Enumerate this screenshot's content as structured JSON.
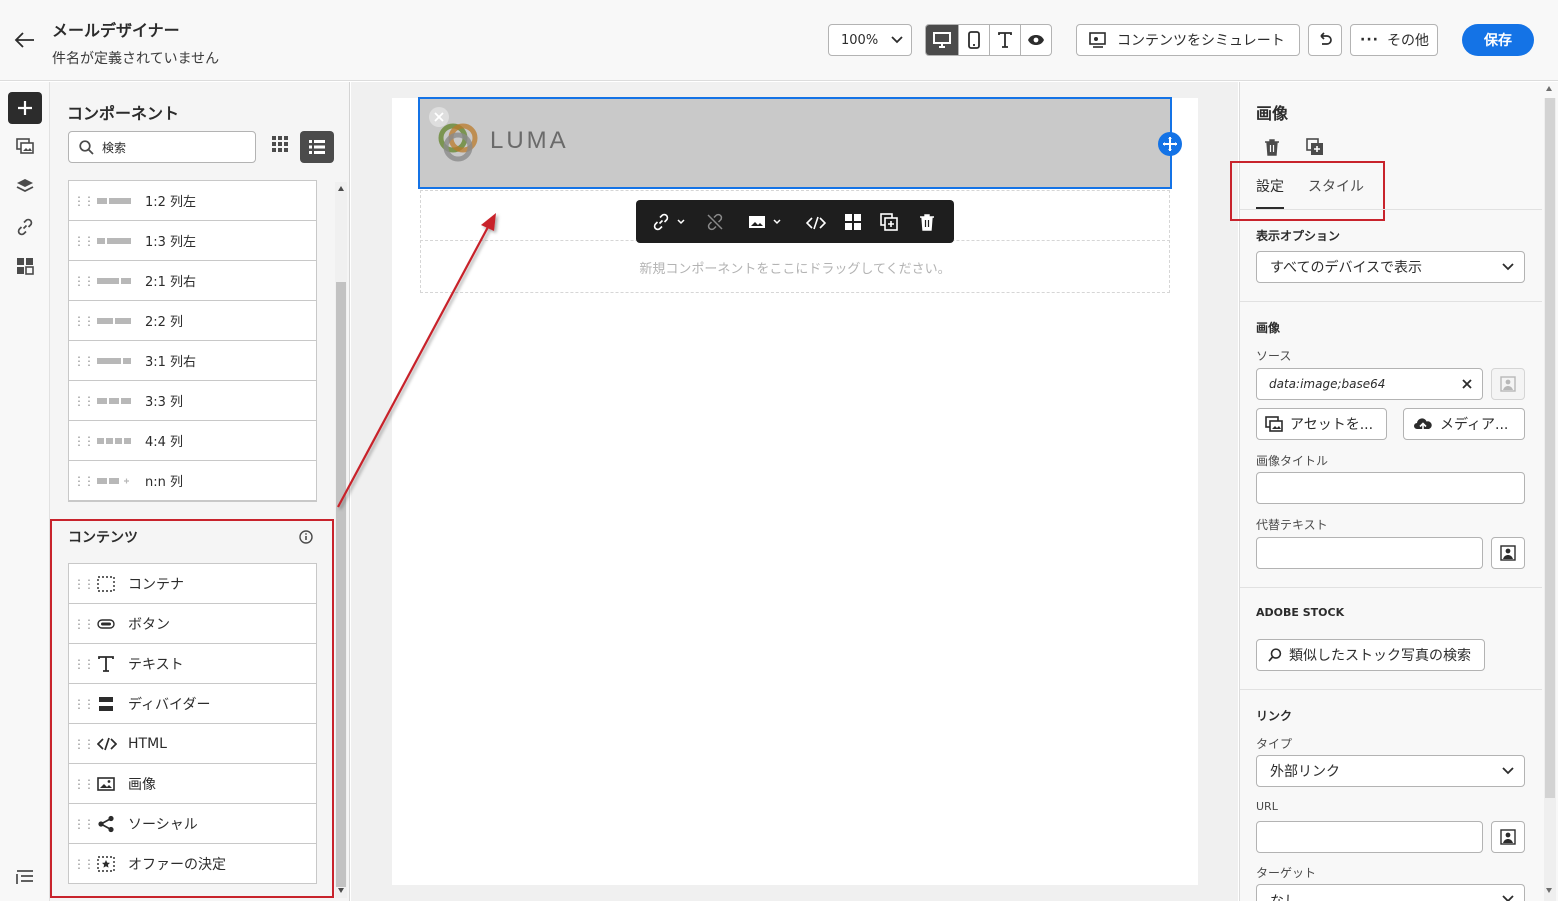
{
  "header": {
    "title": "メールデザイナー",
    "subtitle": "件名が定義されていません",
    "zoom": "100%",
    "simulate_label": "コンテンツをシミュレート",
    "more_label": "その他",
    "save_label": "保存"
  },
  "left_panel": {
    "title": "コンポーネント",
    "search_placeholder": "検索",
    "layouts": [
      {
        "label": "1:2 列左"
      },
      {
        "label": "1:3 列左"
      },
      {
        "label": "2:1 列右"
      },
      {
        "label": "2:2 列"
      },
      {
        "label": "3:1 列右"
      },
      {
        "label": "3:3 列"
      },
      {
        "label": "4:4 列"
      },
      {
        "label": "n:n 列"
      }
    ],
    "contents_title": "コンテンツ",
    "contents": [
      {
        "label": "コンテナ",
        "icon": "container-icon"
      },
      {
        "label": "ボタン",
        "icon": "button-icon"
      },
      {
        "label": "テキスト",
        "icon": "text-icon"
      },
      {
        "label": "ディバイダー",
        "icon": "divider-icon"
      },
      {
        "label": "HTML",
        "icon": "code-icon"
      },
      {
        "label": "画像",
        "icon": "image-icon"
      },
      {
        "label": "ソーシャル",
        "icon": "share-icon"
      },
      {
        "label": "オファーの決定",
        "icon": "offer-icon"
      }
    ]
  },
  "canvas": {
    "logo_text": "LUMA",
    "drop_hint": "新規コンポーネントをここにドラッグしてください。"
  },
  "right_panel": {
    "title": "画像",
    "tabs": [
      "設定",
      "スタイル"
    ],
    "active_tab": "設定",
    "display_options_label": "表示オプション",
    "display_options_value": "すべてのデバイスで表示",
    "image_section": "画像",
    "source_label": "ソース",
    "source_value": "data:image;base64",
    "assets_button": "アセットを...",
    "media_button": "メディア...",
    "image_title_label": "画像タイトル",
    "alt_text_label": "代替テキスト",
    "adobe_stock_label": "ADOBE STOCK",
    "stock_search_button": "類似したストック写真の検索",
    "link_section": "リンク",
    "type_label": "タイプ",
    "type_value": "外部リンク",
    "url_label": "URL",
    "target_label": "ターゲット",
    "target_value": "なし"
  },
  "colors": {
    "accent": "#1473e6",
    "highlight_red": "#c8232c",
    "toolbar_dark": "#1e1e1e",
    "selected_block": "#c9c9c9"
  }
}
